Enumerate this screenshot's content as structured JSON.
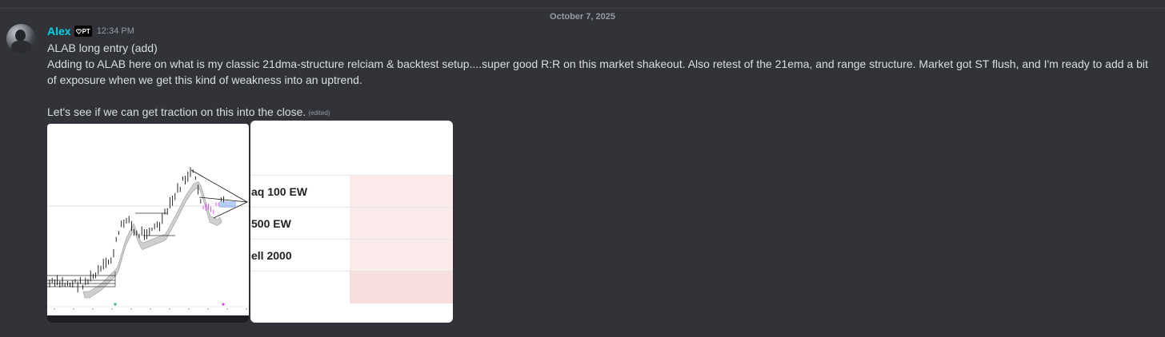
{
  "date_divider": "October 7, 2025",
  "message": {
    "username": "Alex",
    "badge": "PT",
    "timestamp": "12:34 PM",
    "line1": "ALAB long entry (add)",
    "line2": "Adding to ALAB here on what is my classic 21dma-structure relciam & backtest setup....super good R:R on this market shakeout. Also retest of the 21ema, and range structure. Market got ST flush, and I'm ready to add a bit of exposure when we get this kind of weakness into an uptrend.",
    "line3": "Let's see if we can get traction on this into the close.",
    "edited": "(edited)"
  },
  "attachment_table": {
    "rows": [
      "aq 100 EW",
      "500 EW",
      "ell 2000"
    ]
  },
  "colors": {
    "username": "#00d4e8",
    "background": "#313338",
    "candles_highlight": "#e040fb",
    "range_box": "#6d9eeb"
  }
}
